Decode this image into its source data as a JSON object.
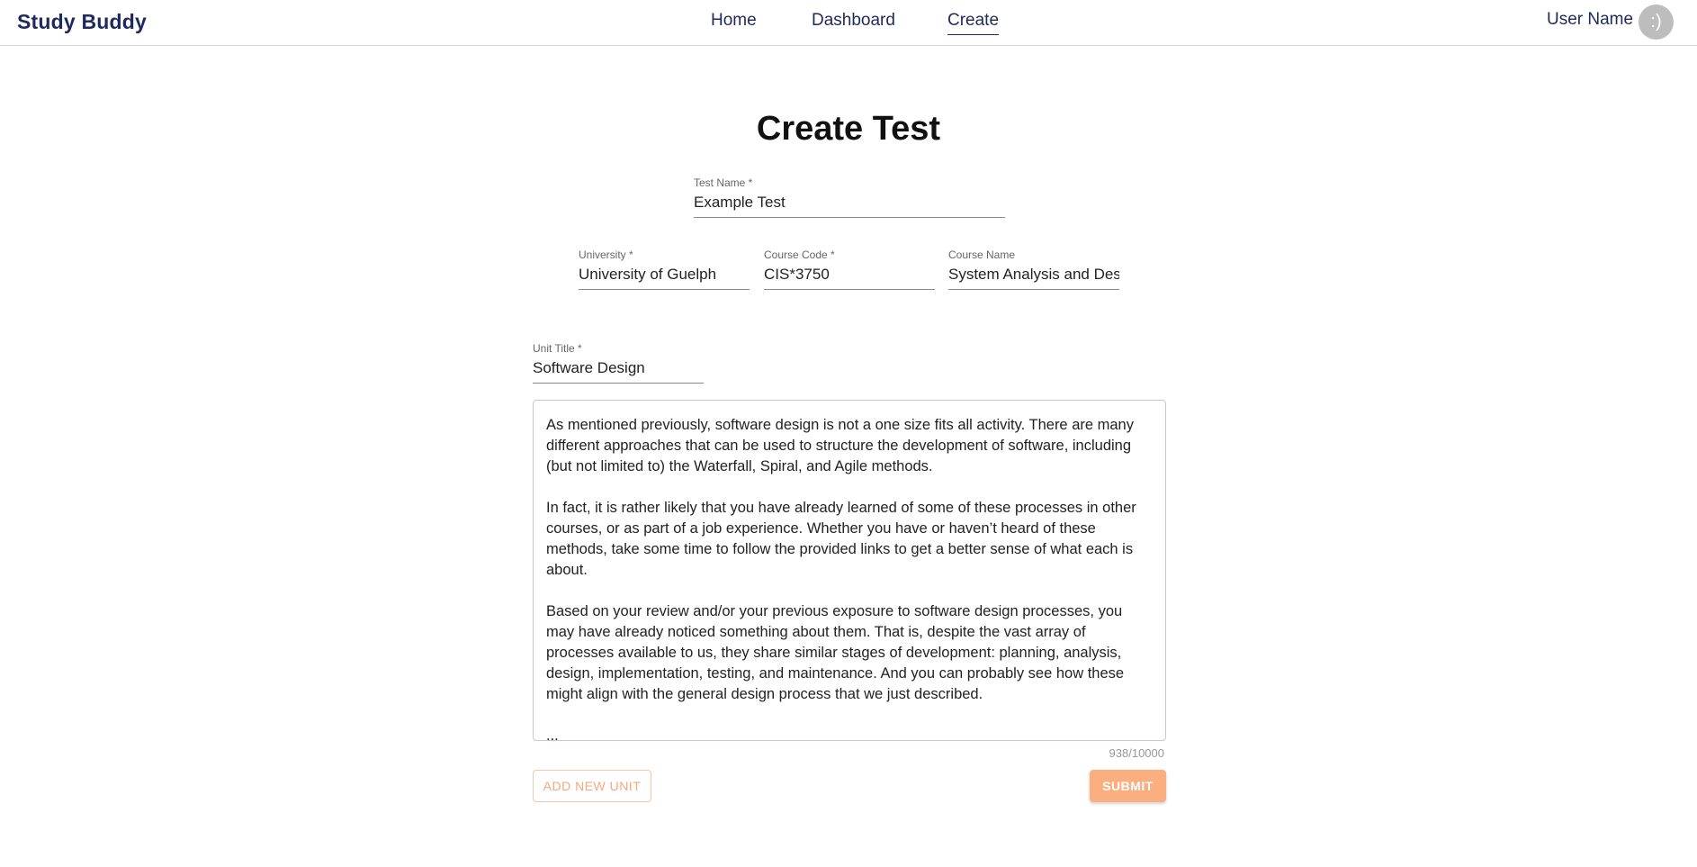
{
  "app": {
    "brand": "Study Buddy"
  },
  "nav": {
    "home": "Home",
    "dashboard": "Dashboard",
    "create": "Create"
  },
  "user": {
    "name": "User Name",
    "avatar_text": ":)"
  },
  "page": {
    "title": "Create Test"
  },
  "form": {
    "test_name": {
      "label": "Test Name *",
      "value": "Example Test"
    },
    "university": {
      "label": "University *",
      "value": "University of Guelph"
    },
    "course_code": {
      "label": "Course Code *",
      "value": "CIS*3750"
    },
    "course_name": {
      "label": "Course Name",
      "value": "System Analysis and Desig"
    },
    "unit_title": {
      "label": "Unit Title *",
      "value": "Software Design"
    },
    "unit_content": {
      "paragraphs": [
        "As mentioned previously, software design is not a one size fits all activity. There are many different approaches that can be used to structure the development of software, including (but not limited to) the Waterfall, Spiral, and Agile methods.",
        "In fact, it is rather likely that you have already learned of some of these processes in other courses, or as part of a job experience. Whether you have or haven’t heard of these methods, take some time to follow the provided links to get a better sense of what each is about.",
        "Based on your review and/or your previous exposure to software design processes, you may have already noticed something about them. That is, despite the vast array of processes available to us, they share similar stages of development: planning, analysis, design, implementation, testing, and maintenance. And you can probably see how these might align with the general design process that we just described.",
        "..."
      ],
      "counter": "938/10000"
    },
    "add_unit_label": "ADD NEW UNIT",
    "submit_label": "SUBMIT"
  },
  "colors": {
    "brand": "#1f2a5c",
    "accent": "#fbae80"
  }
}
